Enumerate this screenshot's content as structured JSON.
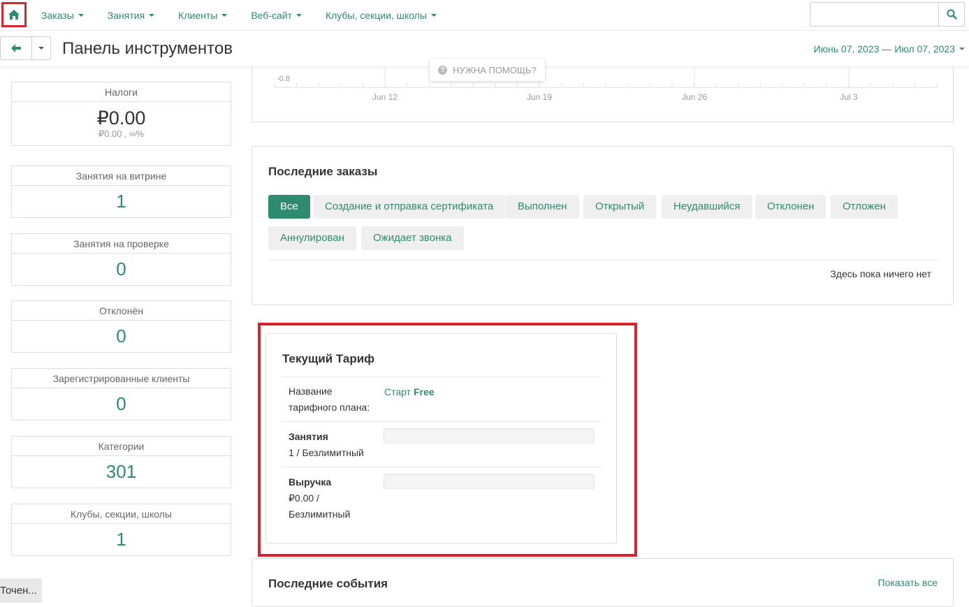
{
  "nav": {
    "items": [
      {
        "label": "Заказы"
      },
      {
        "label": "Занятия"
      },
      {
        "label": "Клиенты"
      },
      {
        "label": "Веб-сайт"
      },
      {
        "label": "Клубы, секции, школы"
      }
    ],
    "search_value": ""
  },
  "header": {
    "title": "Панель инструментов",
    "date_range": "Июнь 07, 2023 — Июл 07, 2023"
  },
  "help": {
    "label": "НУЖНА ПОМОЩЬ?"
  },
  "chart_data": {
    "type": "line",
    "x_ticks": [
      "Jun 12",
      "Jun 19",
      "Jun 26",
      "Jul 3"
    ],
    "y_ticks": [
      "-0.8"
    ]
  },
  "stats": [
    {
      "label": "Налоги",
      "value": "₽0.00",
      "sub": "₽0.00 , ∞%"
    },
    {
      "label": "Занятия на витрине",
      "value": "1"
    },
    {
      "label": "Занятия на проверке",
      "value": "0"
    },
    {
      "label": "Отклонён",
      "value": "0"
    },
    {
      "label": "Зарегистрированные клиенты",
      "value": "0"
    },
    {
      "label": "Категории",
      "value": "301"
    },
    {
      "label": "Клубы, секции, школы",
      "value": "1"
    }
  ],
  "orders": {
    "title": "Последние заказы",
    "filters": [
      {
        "label": "Все"
      },
      {
        "label": "Создание и отправка сертификата"
      },
      {
        "label": "Выполнен"
      },
      {
        "label": "Открытый"
      },
      {
        "label": "Неудавшийся"
      },
      {
        "label": "Отклонен"
      },
      {
        "label": "Отложен"
      },
      {
        "label": "Аннулирован"
      },
      {
        "label": "Ожидает звонка"
      }
    ],
    "empty": "Здесь пока ничего нет"
  },
  "tariff": {
    "title": "Текущий Тариф",
    "plan_label_1": "Название",
    "plan_label_2": "тарифного плана:",
    "plan_name": "Старт",
    "plan_tier": "Free",
    "classes_label": "Занятия",
    "classes_usage": "1 / Безлимитный",
    "classes_fill": 0,
    "revenue_label": "Выручка",
    "revenue_usage_1": "₽0.00 /",
    "revenue_usage_2": "Безлимитный",
    "revenue_fill": 0
  },
  "events": {
    "title": "Последние события",
    "show_all": "Показать все"
  },
  "bottom_button": "Точен..."
}
